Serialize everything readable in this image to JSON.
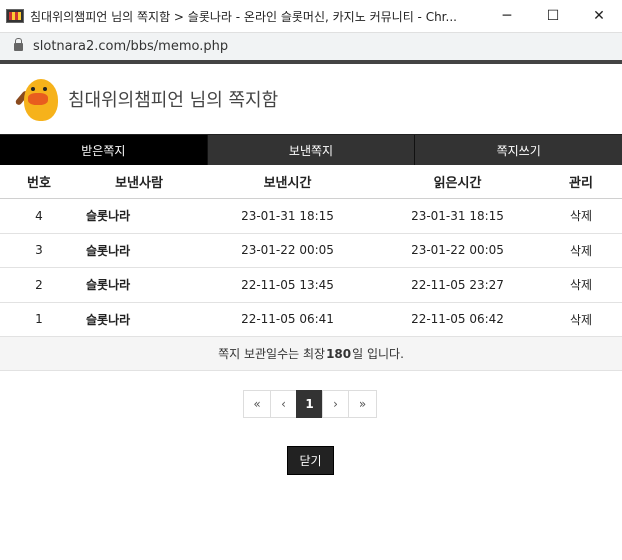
{
  "window": {
    "title": "침대위의챔피언 님의 쪽지함 > 슬롯나라 - 온라인 슬롯머신, 카지노 커뮤니티 - Chr...",
    "minimize": "─",
    "maximize": "☐",
    "close": "✕"
  },
  "address": {
    "url": "slotnara2.com/bbs/memo.php"
  },
  "header": {
    "title": "침대위의챔피언 님의 쪽지함"
  },
  "tabs": [
    {
      "label": "받은쪽지",
      "active": true
    },
    {
      "label": "보낸쪽지",
      "active": false
    },
    {
      "label": "쪽지쓰기",
      "active": false
    }
  ],
  "table": {
    "columns": [
      "번호",
      "보낸사람",
      "보낸시간",
      "읽은시간",
      "관리"
    ],
    "rows": [
      {
        "no": "4",
        "sender": "슬롯나라",
        "sent": "23-01-31 18:15",
        "read": "23-01-31 18:15",
        "action": "삭제"
      },
      {
        "no": "3",
        "sender": "슬롯나라",
        "sent": "23-01-22 00:05",
        "read": "23-01-22 00:05",
        "action": "삭제"
      },
      {
        "no": "2",
        "sender": "슬롯나라",
        "sent": "22-11-05 13:45",
        "read": "22-11-05 23:27",
        "action": "삭제"
      },
      {
        "no": "1",
        "sender": "슬롯나라",
        "sent": "22-11-05 06:41",
        "read": "22-11-05 06:42",
        "action": "삭제"
      }
    ]
  },
  "notice": {
    "prefix": "쪽지 보관일수는 최장 ",
    "days": "180",
    "suffix": "일 입니다."
  },
  "pagination": {
    "first": "«",
    "prev": "‹",
    "current": "1",
    "next": "›",
    "last": "»"
  },
  "close_button": "닫기"
}
